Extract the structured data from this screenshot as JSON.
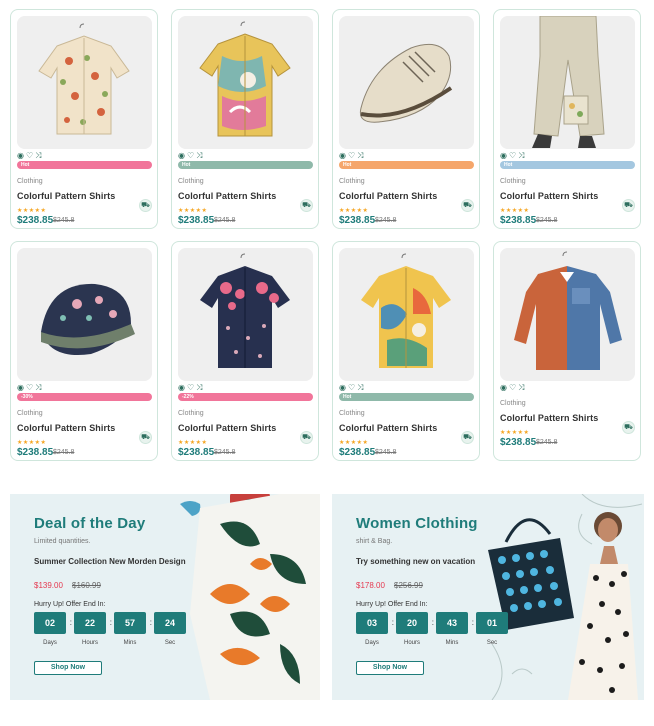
{
  "products": [
    {
      "category": "Clothing",
      "title": "Colorful Pattern Shirts",
      "price": "$238.85",
      "old_price": "$245.8",
      "badge": "Hot",
      "badge_color": "#f1759a",
      "image": "mushroom-shirt"
    },
    {
      "category": "Clothing",
      "title": "Colorful Pattern Shirts",
      "price": "$238.85",
      "old_price": "$245.8",
      "badge": "Hot",
      "badge_color": "#8fb9aa",
      "image": "abstract-shirt"
    },
    {
      "category": "Clothing",
      "title": "Colorful Pattern Shirts",
      "price": "$238.85",
      "old_price": "$245.8",
      "badge": "Hot",
      "badge_color": "#f5a66b",
      "image": "sneaker"
    },
    {
      "category": "Clothing",
      "title": "Colorful Pattern Shirts",
      "price": "$238.85",
      "old_price": "$245.8",
      "badge": "Hot",
      "badge_color": "#a4c7e0",
      "image": "linen-pants"
    },
    {
      "category": "Clothing",
      "title": "Colorful Pattern Shirts",
      "price": "$238.85",
      "old_price": "$245.8",
      "badge": "-30%",
      "badge_color": "#f1759a",
      "image": "beanie"
    },
    {
      "category": "Clothing",
      "title": "Colorful Pattern Shirts",
      "price": "$238.85",
      "old_price": "$245.8",
      "badge": "-22%",
      "badge_color": "#f1759a",
      "image": "floral-navy-shirt"
    },
    {
      "category": "Clothing",
      "title": "Colorful Pattern Shirts",
      "price": "$238.85",
      "old_price": "$245.8",
      "badge": "Hot",
      "badge_color": "#8fb9aa",
      "image": "tropical-shirt"
    },
    {
      "category": "Clothing",
      "title": "Colorful Pattern Shirts",
      "price": "$238.85",
      "old_price": "$245.8",
      "badge": "",
      "badge_color": "",
      "image": "patchwork-shirt"
    }
  ],
  "banners": [
    {
      "title": "Deal of the Day",
      "subtitle": "Limited quantities.",
      "description": "Summer Collection New Morden Design",
      "price": "$139.00",
      "old_price": "$160.99",
      "hurry": "Hurry Up! Offer End In:",
      "countdown": [
        {
          "value": "02",
          "label": "Days"
        },
        {
          "value": "22",
          "label": "Hours"
        },
        {
          "value": "57",
          "label": "Mins"
        },
        {
          "value": "24",
          "label": "Sec"
        }
      ],
      "button": "Shop Now"
    },
    {
      "title": "Women Clothing",
      "subtitle": "shirt & Bag.",
      "description": "Try something new on vacation",
      "price": "$178.00",
      "old_price": "$256.99",
      "hurry": "Hurry Up! Offer End In:",
      "countdown": [
        {
          "value": "03",
          "label": "Days"
        },
        {
          "value": "20",
          "label": "Hours"
        },
        {
          "value": "43",
          "label": "Mins"
        },
        {
          "value": "01",
          "label": "Sec"
        }
      ],
      "button": "Shop Now"
    }
  ],
  "colors": {
    "accent": "#1f7c7a",
    "sale": "#e53950",
    "border": "#cfe6dc"
  }
}
